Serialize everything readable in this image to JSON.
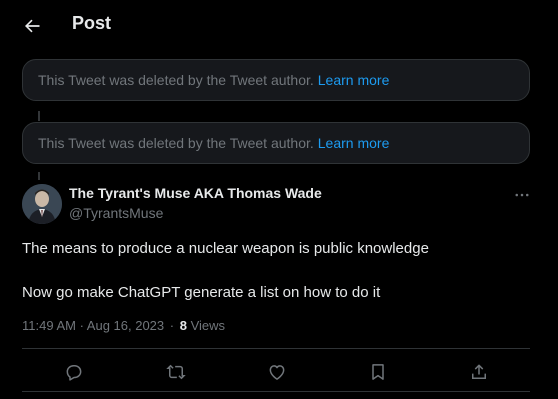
{
  "header": {
    "title": "Post",
    "back_icon": "arrow-left-icon"
  },
  "deleted_notices": [
    {
      "text": "This Tweet was deleted by the Tweet author.",
      "link": "Learn more"
    },
    {
      "text": "This Tweet was deleted by the Tweet author.",
      "link": "Learn more"
    }
  ],
  "tweet": {
    "author_name": "The Tyrant's Muse AKA Thomas Wade",
    "author_handle": "@TyrantsMuse",
    "text_line_1": "The means to produce a nuclear weapon is public knowledge",
    "text_line_2": "Now go make ChatGPT generate a list on how to do it",
    "timestamp": "11:49 AM · Aug 16, 2023",
    "separator": "·",
    "views_count": "8",
    "views_label": "Views",
    "more_icon": "more-horizontal-icon"
  },
  "actions": {
    "reply_icon": "reply-icon",
    "retweet_icon": "retweet-icon",
    "like_icon": "heart-icon",
    "bookmark_icon": "bookmark-icon",
    "share_icon": "share-icon"
  },
  "colors": {
    "background": "#000000",
    "link": "#1d9bf0",
    "muted": "#71767b",
    "text": "#e7e9ea",
    "border": "#2f3336"
  }
}
